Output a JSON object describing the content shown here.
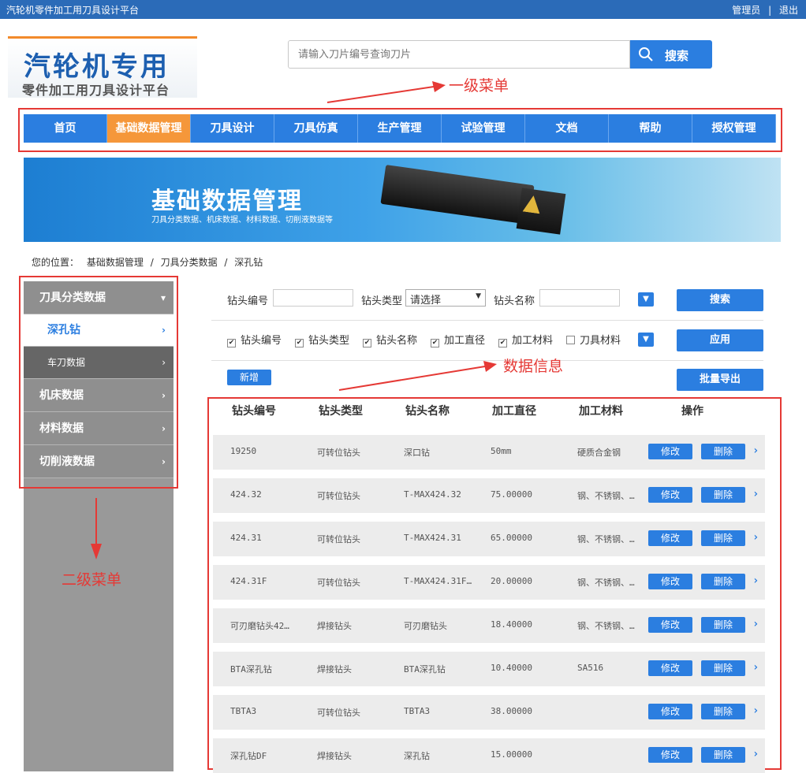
{
  "topbar": {
    "title": "汽轮机零件加工用刀具设计平台",
    "user": "管理员",
    "sep": "|",
    "logout": "退出"
  },
  "logo": {
    "line1": "汽轮机专用",
    "line2": "零件加工用刀具设计平台"
  },
  "search": {
    "placeholder": "请输入刀片编号查询刀片",
    "button": "搜索"
  },
  "annotations": {
    "menu1": "一级菜单",
    "data_info": "数据信息",
    "menu2": "二级菜单"
  },
  "nav": [
    "首页",
    "基础数据管理",
    "刀具设计",
    "刀具仿真",
    "生产管理",
    "试验管理",
    "文档",
    "帮助",
    "授权管理"
  ],
  "banner": {
    "title": "基础数据管理",
    "subtitle": "刀具分类数据、机床数据、材料数据、切削液数据等"
  },
  "breadcrumb": {
    "prefix": "您的位置：",
    "l1": "基础数据管理",
    "s1": "/",
    "l2": "刀具分类数据",
    "s2": "/",
    "l3": "深孔钻"
  },
  "sidebar": {
    "group1": "刀具分类数据",
    "sub_active": "深孔钻",
    "sub2": "车刀数据",
    "group2": "机床数据",
    "group3": "材料数据",
    "group4": "切削液数据"
  },
  "filters": {
    "code_label": "钻头编号",
    "type_label": "钻头类型",
    "type_value": "请选择",
    "name_label": "钻头名称",
    "search_btn": "搜索",
    "apply_btn": "应用",
    "add_btn": "新增",
    "export_btn": "批量导出",
    "columns": [
      {
        "label": "钻头编号",
        "checked": true
      },
      {
        "label": "钻头类型",
        "checked": true
      },
      {
        "label": "钻头名称",
        "checked": true
      },
      {
        "label": "加工直径",
        "checked": true
      },
      {
        "label": "加工材料",
        "checked": true
      },
      {
        "label": "刀具材料",
        "checked": false
      }
    ]
  },
  "table": {
    "headers": [
      "钻头编号",
      "钻头类型",
      "钻头名称",
      "加工直径",
      "加工材料",
      "操作"
    ],
    "edit": "修改",
    "delete": "删除",
    "rows": [
      [
        "19250",
        "可转位钻头",
        "深口钻",
        "50mm",
        "硬质合金钢"
      ],
      [
        "424.32",
        "可转位钻头",
        "T-MAX424.32",
        "75.00000",
        "钢、不锈钢、…"
      ],
      [
        "424.31",
        "可转位钻头",
        "T-MAX424.31",
        "65.00000",
        "钢、不锈钢、…"
      ],
      [
        "424.31F",
        "可转位钻头",
        "T-MAX424.31F…",
        "20.00000",
        "钢、不锈钢、…"
      ],
      [
        "可刃磨钻头42…",
        "焊接钻头",
        "可刃磨钻头",
        "18.40000",
        "钢、不锈钢、…"
      ],
      [
        "BTA深孔钻",
        "焊接钻头",
        "BTA深孔钻",
        "10.40000",
        "SA516"
      ],
      [
        "TBTA3",
        "可转位钻头",
        "TBTA3",
        "38.00000",
        ""
      ],
      [
        "深孔钻DF",
        "焊接钻头",
        "深孔钻",
        "15.00000",
        ""
      ]
    ]
  }
}
